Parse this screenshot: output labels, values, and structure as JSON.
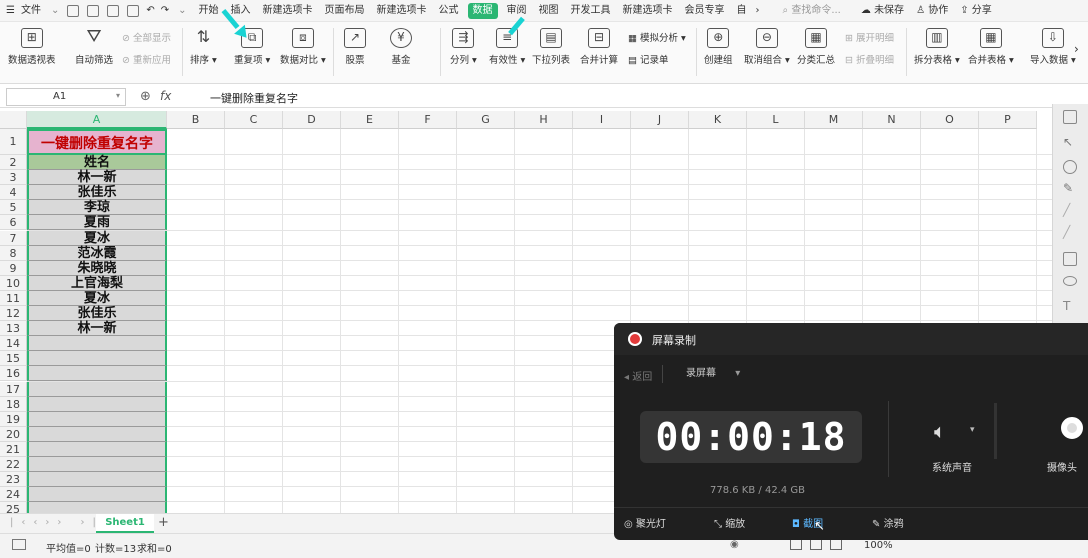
{
  "menubar": {
    "file_label": "文件",
    "tabs": [
      "开始",
      "插入",
      "新建选项卡",
      "页面布局",
      "新建选项卡",
      "公式",
      "数据",
      "审阅",
      "视图",
      "开发工具",
      "新建选项卡",
      "会员专享",
      "自"
    ],
    "active_tab": "数据",
    "search_placeholder": "查找命令...",
    "unsaved": "未保存",
    "collab": "协作",
    "share": "分享"
  },
  "ribbon": {
    "pivot": "数据透视表",
    "autofilter": "自动筛选",
    "show_all": "全部显示",
    "reapply": "重新应用",
    "sort": "排序",
    "duplicates": "重复项",
    "compare": "数据对比",
    "stocks": "股票",
    "fund": "基金",
    "split": "分列",
    "validity": "有效性",
    "dropdown": "下拉列表",
    "consolidate": "合并计算",
    "simulate": "模拟分析",
    "record": "记录单",
    "group": "创建组",
    "ungroup": "取消组合",
    "subtotal": "分类汇总",
    "expand": "展开明细",
    "collapse": "折叠明细",
    "split_table": "拆分表格",
    "merge_table": "合并表格",
    "import": "导入数据"
  },
  "formula_bar": {
    "cell_ref": "A1",
    "fx": "fx",
    "content": "一键删除重复名字"
  },
  "grid": {
    "columns": [
      "A",
      "B",
      "C",
      "D",
      "E",
      "F",
      "G",
      "H",
      "I",
      "J",
      "K",
      "L",
      "M",
      "N",
      "O",
      "P"
    ],
    "rows": [
      "1",
      "2",
      "3",
      "4",
      "5",
      "6",
      "7",
      "8",
      "9",
      "10",
      "11",
      "12",
      "13",
      "14",
      "15",
      "16",
      "17",
      "18",
      "19",
      "20",
      "21",
      "22",
      "23",
      "24",
      "25"
    ],
    "title": "一键删除重复名字",
    "header": "姓名",
    "names": [
      "林一新",
      "张佳乐",
      "李琼",
      "夏雨",
      "夏冰",
      "范冰霞",
      "朱晓晓",
      "上官海梨",
      "夏冰",
      "张佳乐",
      "林一新"
    ]
  },
  "sheet_tab": "Sheet1",
  "status": {
    "avg": "平均值=0",
    "count": "计数=13",
    "sum": "求和=0",
    "zoom": "100%"
  },
  "recorder": {
    "title": "屏幕录制",
    "back": "返回",
    "mode": "录屏幕",
    "time": "00:00:18",
    "size": "778.6 KB / 42.4 GB",
    "sys_audio": "系统声音",
    "camera": "摄像头",
    "spotlight": "聚光灯",
    "zoom": "缩放",
    "screenshot": "截图",
    "draw": "涂鸦"
  },
  "colors": {
    "accent": "#2bb673",
    "title_text": "#c00000",
    "title_bg": "#e6b3cf",
    "header_bg": "#a9c99a",
    "cell_bg": "#d9d9d9",
    "arrow": "#19d3d3",
    "rec_red": "#e23b3b"
  }
}
